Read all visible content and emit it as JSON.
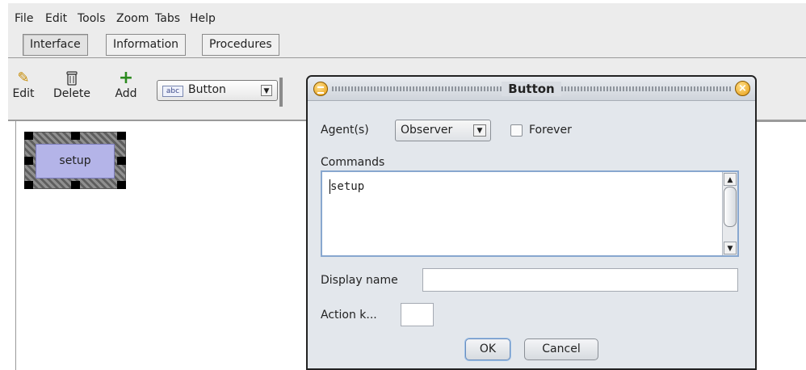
{
  "menubar": {
    "items": [
      "File",
      "Edit",
      "Tools",
      "Zoom",
      "Tabs",
      "Help"
    ]
  },
  "tabs": [
    {
      "label": "Interface",
      "active": true
    },
    {
      "label": "Information",
      "active": false
    },
    {
      "label": "Procedures",
      "active": false
    }
  ],
  "toolbar": {
    "edit_label": "Edit",
    "delete_label": "Delete",
    "add_label": "Add",
    "widget_type_icon": "abc",
    "widget_type_value": "Button"
  },
  "canvas": {
    "button_label": "setup"
  },
  "dialog": {
    "title": "Button",
    "agents_label": "Agent(s)",
    "agents_value": "Observer",
    "forever_label": "Forever",
    "forever_checked": false,
    "commands_label": "Commands",
    "commands_value": "setup",
    "display_name_label": "Display name",
    "display_name_value": "",
    "action_key_label": "Action k...",
    "action_key_value": "",
    "ok_label": "OK",
    "cancel_label": "Cancel"
  },
  "colors": {
    "button_fill": "#b4b4e8",
    "dialog_bg": "#e3e7ec",
    "add_icon": "#2a8a1e",
    "title_control": "#e69a10"
  },
  "icons": [
    "pencil-icon",
    "trash-icon",
    "plus-icon",
    "dropdown-arrow-icon",
    "menu-circle-icon",
    "close-circle-icon",
    "scroll-up-icon",
    "scroll-down-icon"
  ]
}
